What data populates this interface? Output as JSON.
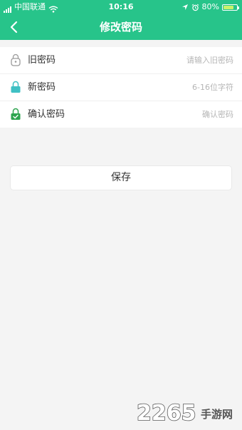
{
  "status_bar": {
    "carrier": "中国联通",
    "time": "10:16",
    "battery_percent": "80%",
    "battery_level": 0.8
  },
  "nav": {
    "title": "修改密码"
  },
  "form": {
    "rows": [
      {
        "label": "旧密码",
        "placeholder": "请输入旧密码",
        "icon": "user-lock-icon"
      },
      {
        "label": "新密码",
        "placeholder": "6-16位字符",
        "icon": "lock-icon"
      },
      {
        "label": "确认密码",
        "placeholder": "确认密码",
        "icon": "lock-check-icon"
      }
    ]
  },
  "save_label": "保存",
  "watermark": {
    "number": "2265",
    "text": "手游网"
  },
  "colors": {
    "accent": "#27c48a",
    "lock_teal": "#3fc0c4",
    "lock_green": "#2ea44f"
  }
}
